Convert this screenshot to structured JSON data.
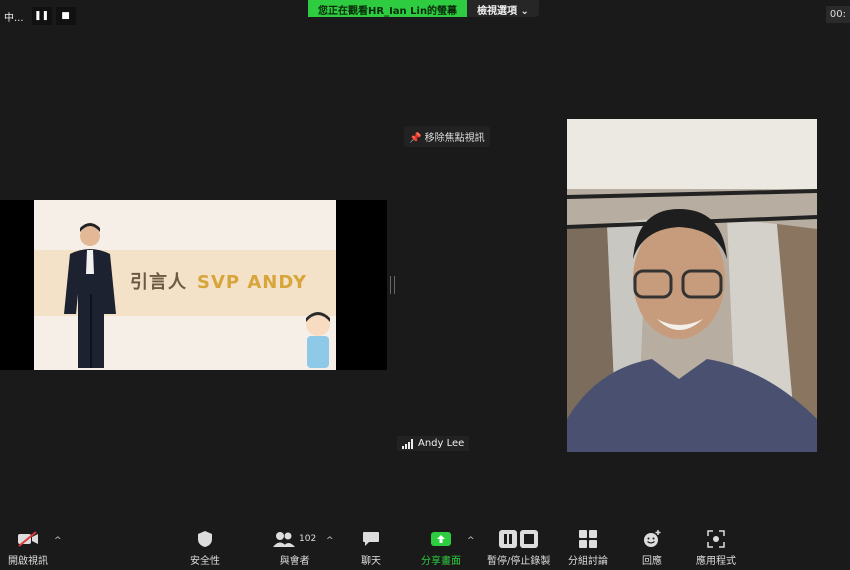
{
  "top": {
    "recording_label": "中...",
    "banner_text": "您正在觀看HR_Ian Lin的螢幕",
    "view_options": "檢視選項",
    "timer": "00:"
  },
  "unpin_label": "移除焦點視訊",
  "slide": {
    "title_a": "引言人",
    "title_b": "SVP ANDY"
  },
  "participant": {
    "name": "Andy Lee"
  },
  "toolbar": {
    "video": "開啟視訊",
    "security": "安全性",
    "participants": "與會者",
    "participants_count": "102",
    "chat": "聊天",
    "share": "分享畫面",
    "record": "暫停/停止錄製",
    "breakout": "分組討論",
    "reactions": "回應",
    "apps": "應用程式"
  },
  "colors": {
    "accent_green": "#2ecc40",
    "background": "#1a1a1a"
  }
}
